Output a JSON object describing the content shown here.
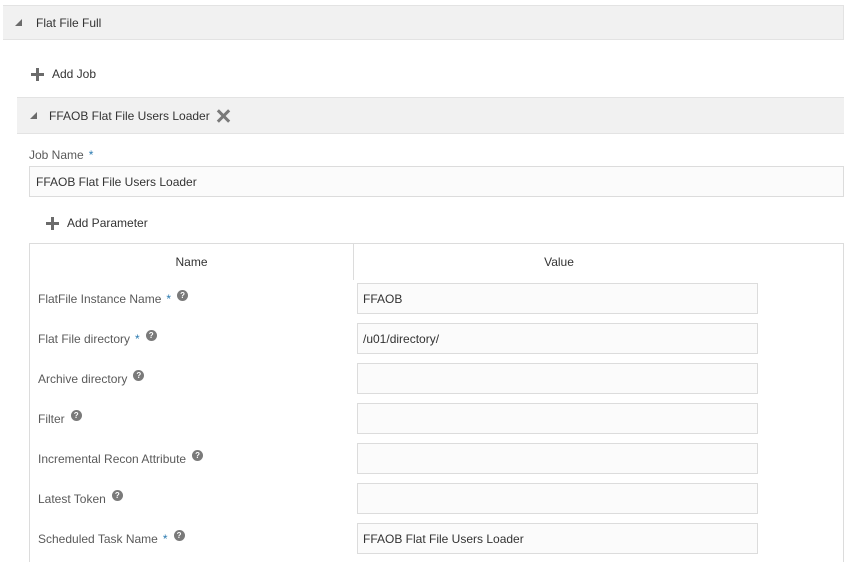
{
  "section": {
    "title": "Flat File Full"
  },
  "add_job": {
    "label": "Add Job"
  },
  "job": {
    "title": "FFAOB Flat File Users Loader",
    "name_label": "Job Name",
    "required_mark": "*",
    "name_value": "FFAOB Flat File Users Loader"
  },
  "add_parameter": {
    "label": "Add Parameter"
  },
  "table": {
    "headers": {
      "name": "Name",
      "value": "Value"
    },
    "rows": [
      {
        "label": "FlatFile Instance Name",
        "required": "*",
        "value": "FFAOB"
      },
      {
        "label": "Flat File directory",
        "required": "*",
        "value": "/u01/directory/"
      },
      {
        "label": "Archive directory",
        "required": "",
        "value": ""
      },
      {
        "label": "Filter",
        "required": "",
        "value": ""
      },
      {
        "label": "Incremental Recon Attribute",
        "required": "",
        "value": ""
      },
      {
        "label": "Latest Token",
        "required": "",
        "value": ""
      },
      {
        "label": "Scheduled Task Name",
        "required": "*",
        "value": "FFAOB Flat File Users Loader"
      }
    ]
  },
  "icons": {
    "help": "?"
  },
  "colors": {
    "accent_required": "#2a7ab0",
    "header_bg": "#f1f1f1"
  }
}
